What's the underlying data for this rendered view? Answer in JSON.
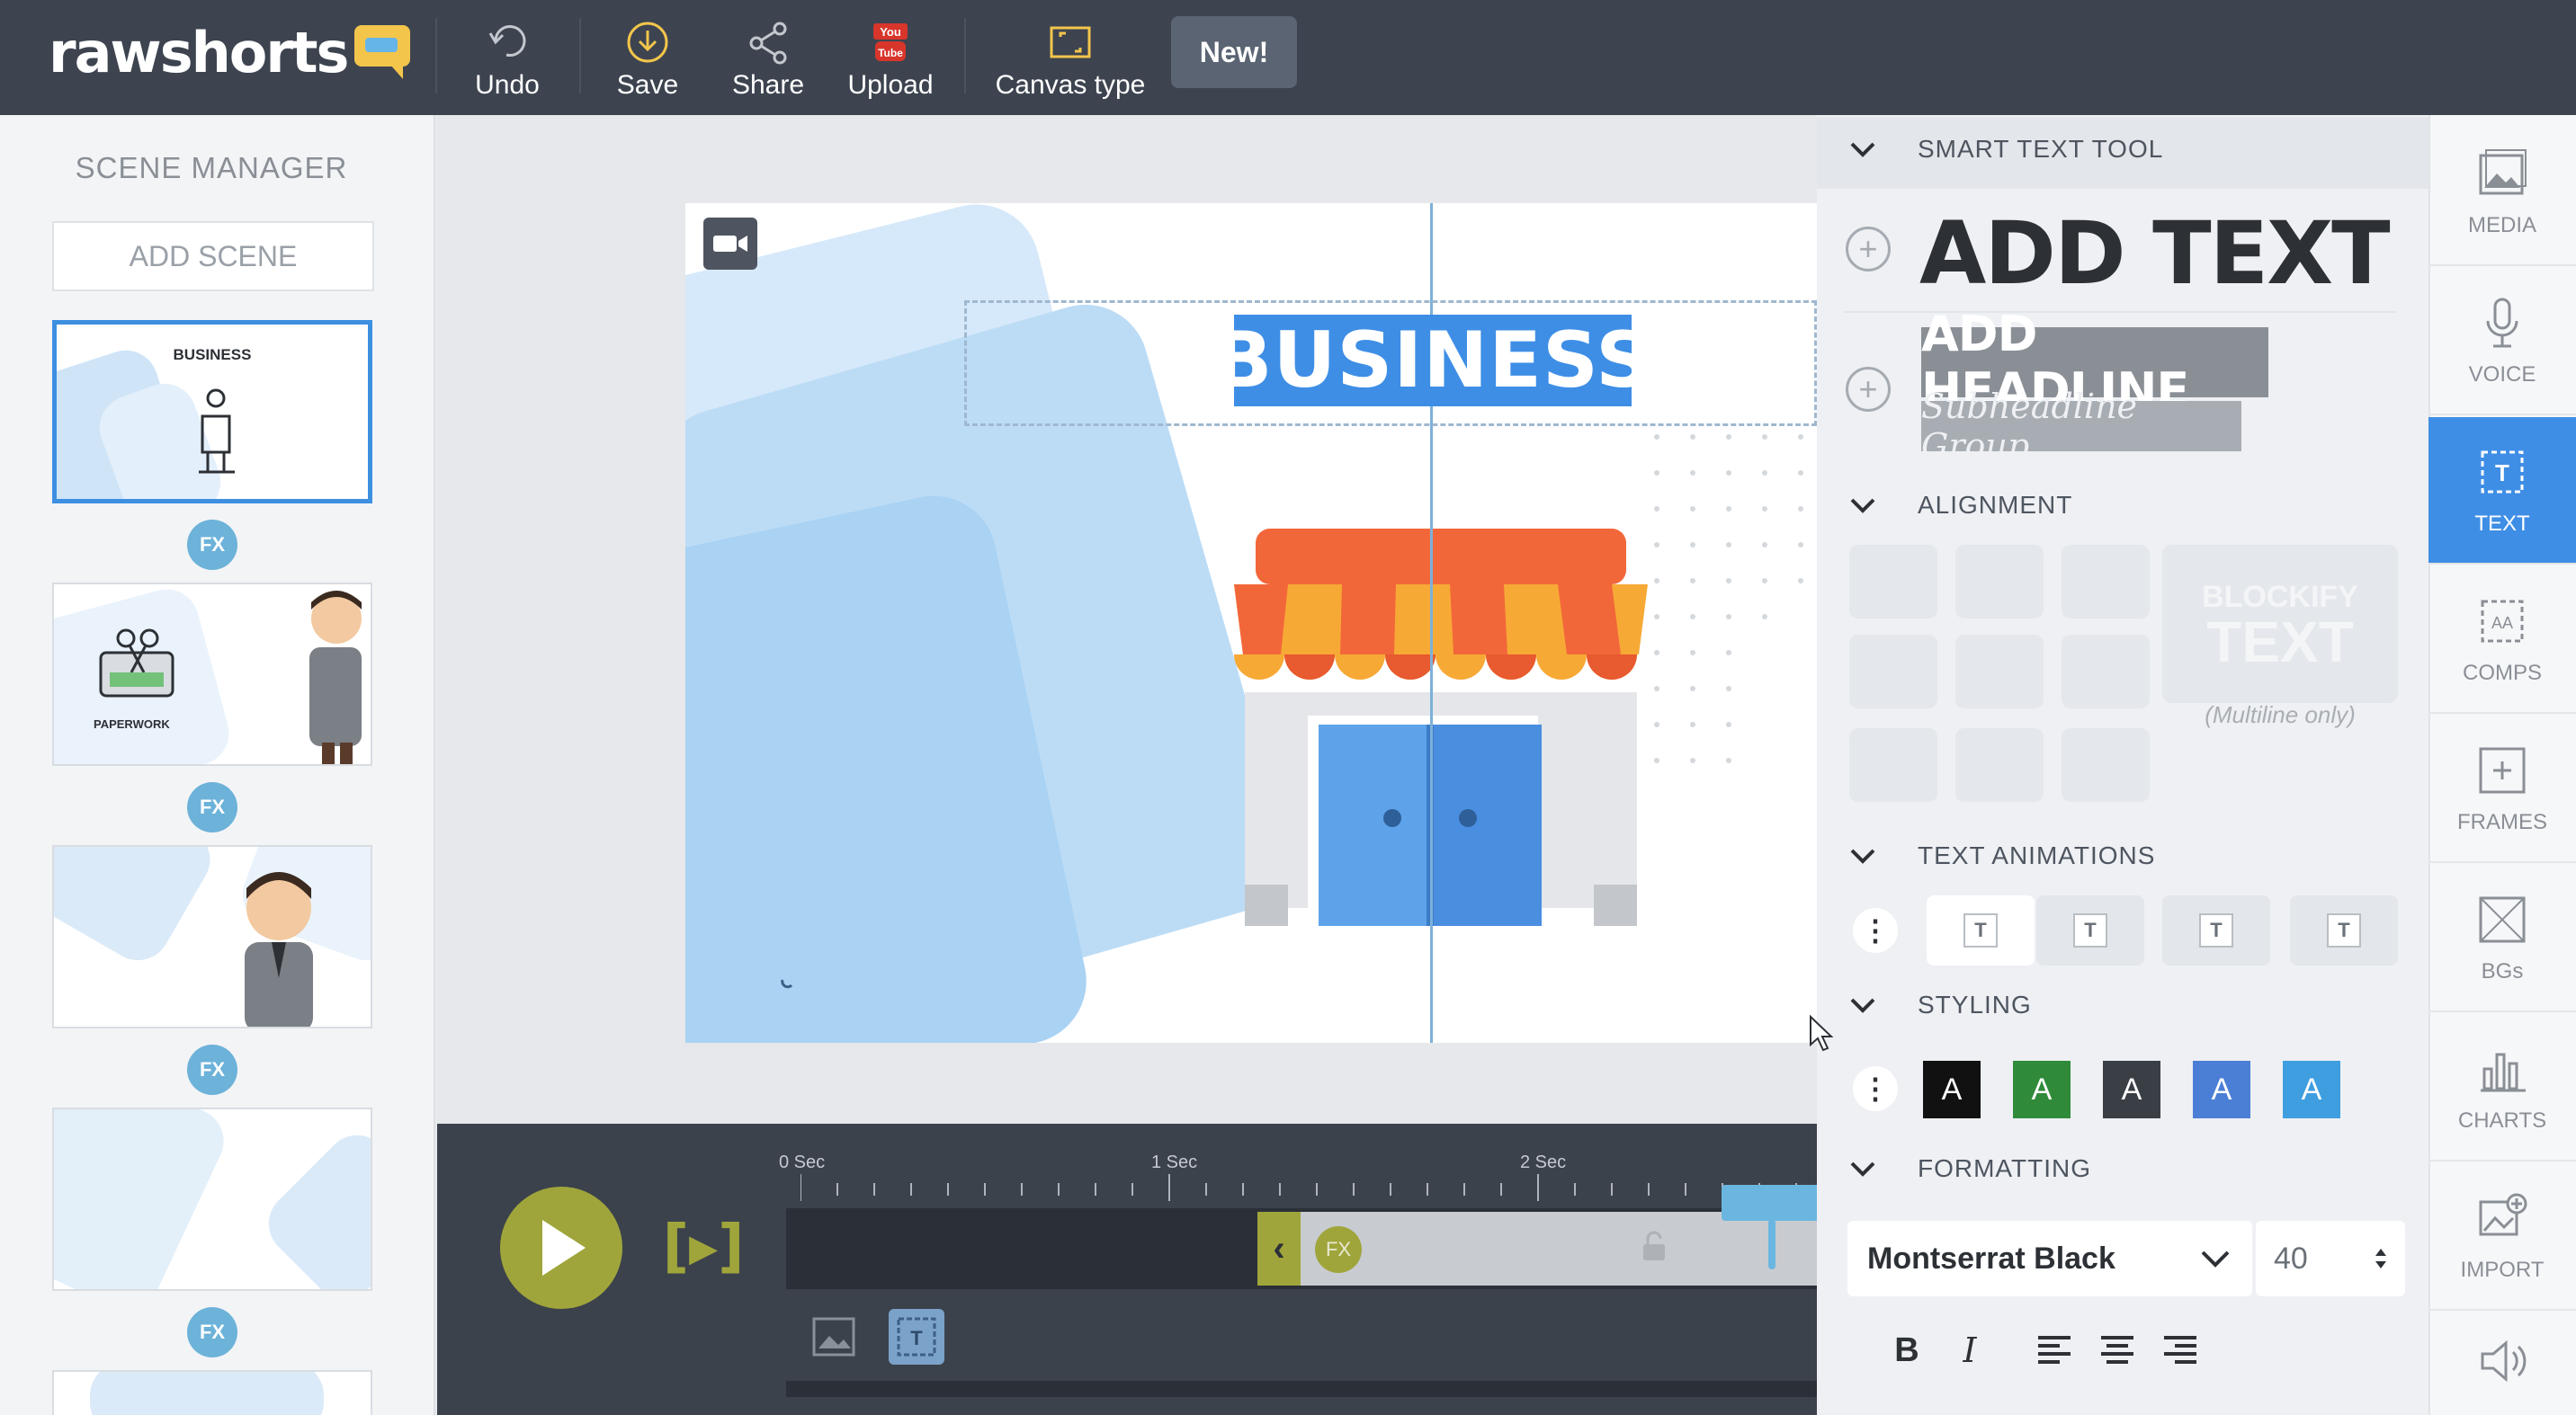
{
  "app": {
    "logo": "rawshorts"
  },
  "toolbar": {
    "undo": "Undo",
    "save": "Save",
    "share": "Share",
    "upload": "Upload",
    "canvas_type": "Canvas type",
    "new_badge": "New!"
  },
  "scene_manager": {
    "title": "SCENE MANAGER",
    "add_scene": "ADD SCENE",
    "scenes": [
      {
        "label": "BUSINESS",
        "active": true
      },
      {
        "label": "PAPERWORK",
        "active": false
      },
      {
        "label": "",
        "active": false
      },
      {
        "label": "",
        "active": false
      }
    ],
    "fx_label": "FX"
  },
  "canvas": {
    "headline": "BUSINESS"
  },
  "timeline": {
    "ruler": [
      "0 Sec",
      "1 Sec",
      "2 Sec"
    ],
    "clip_fx": "FX"
  },
  "smart_text": {
    "section_title": "SMART TEXT TOOL",
    "add_text": "ADD TEXT",
    "add_headline": "ADD HEADLINE",
    "subheadline": "Subheadline Group"
  },
  "alignment": {
    "section_title": "ALIGNMENT",
    "blockify_line1": "BLOCKIFY",
    "blockify_line2": "TEXT",
    "multiline_note": "(Multiline only)"
  },
  "text_animations": {
    "section_title": "TEXT ANIMATIONS",
    "glyph": "T"
  },
  "styling": {
    "section_title": "STYLING",
    "swatch_glyph": "A",
    "swatch_colors": [
      "#111111",
      "#2f8a3a",
      "#3a3f46",
      "#4b7fd6",
      "#3f9ee0"
    ]
  },
  "formatting": {
    "section_title": "FORMATTING",
    "font": "Montserrat Black",
    "size": "40",
    "bold": "B",
    "italic": "I"
  },
  "rail": [
    {
      "label": "MEDIA",
      "icon": "image-icon"
    },
    {
      "label": "VOICE",
      "icon": "microphone-icon"
    },
    {
      "label": "TEXT",
      "icon": "text-icon"
    },
    {
      "label": "COMPS",
      "icon": "comps-icon"
    },
    {
      "label": "FRAMES",
      "icon": "frame-icon"
    },
    {
      "label": "BGs",
      "icon": "background-icon"
    },
    {
      "label": "CHARTS",
      "icon": "chart-icon"
    },
    {
      "label": "IMPORT",
      "icon": "import-icon"
    }
  ],
  "colors": {
    "topbar": "#3d4450",
    "accent_blue": "#3e8ee6",
    "timeline_green": "#a0a53b"
  }
}
